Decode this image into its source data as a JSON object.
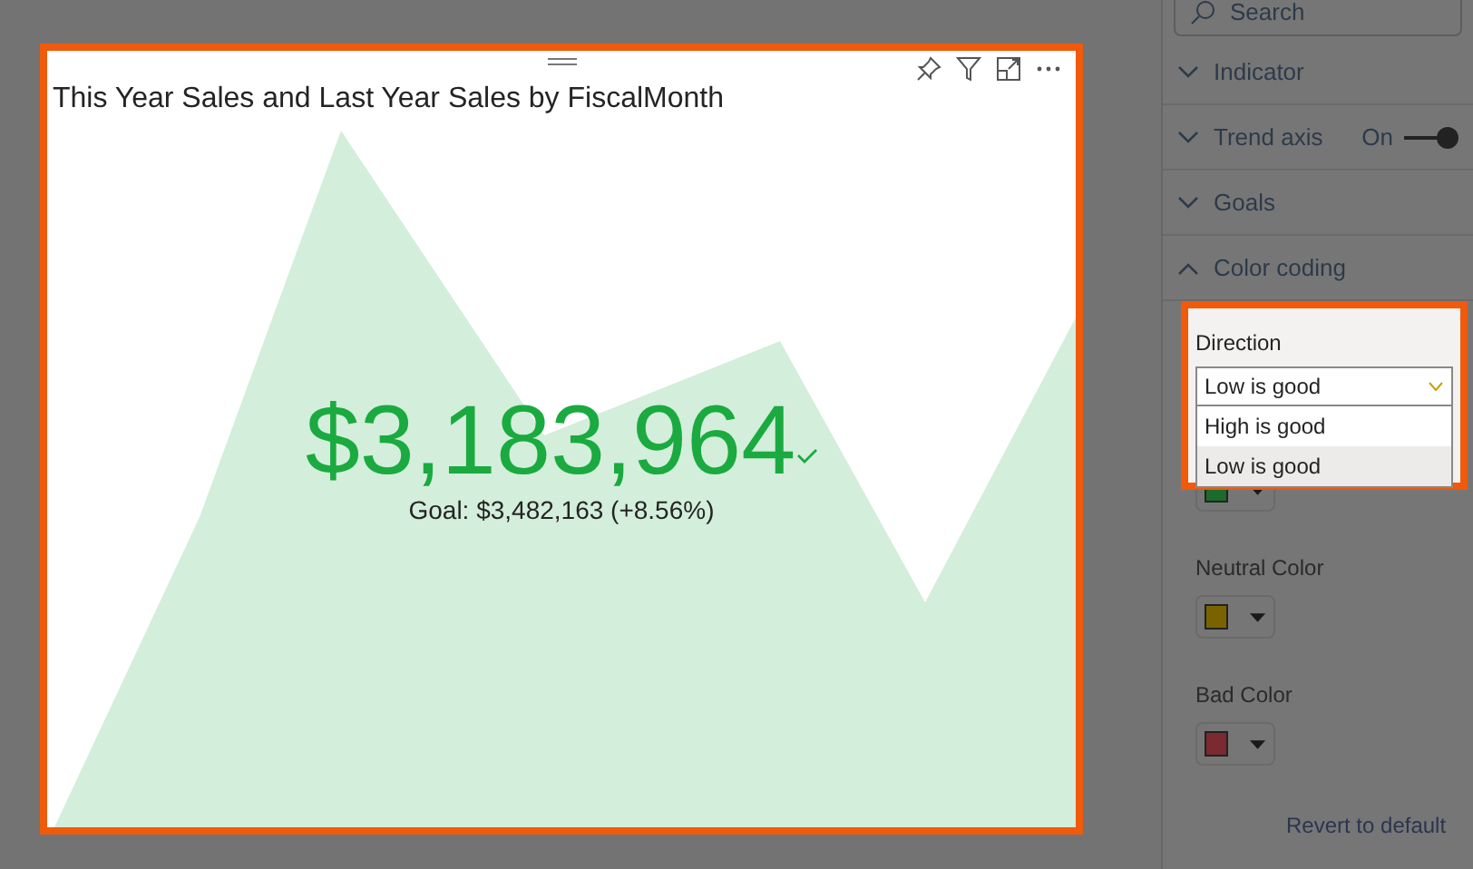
{
  "visual": {
    "title": "This Year Sales and Last Year Sales by FiscalMonth",
    "value": "$3,183,964",
    "goal": "Goal: $3,482,163 (+8.56%)"
  },
  "pane": {
    "search": {
      "placeholder": "Search"
    },
    "sections": [
      {
        "label": "Indicator",
        "expanded": false
      },
      {
        "label": "Trend axis",
        "expanded": false,
        "toggle_label": "On",
        "on": true
      },
      {
        "label": "Goals",
        "expanded": false
      },
      {
        "label": "Color coding",
        "expanded": true
      }
    ],
    "direction": {
      "label": "Direction",
      "value": "Low is good",
      "options": [
        {
          "label": "High is good",
          "selected": false
        },
        {
          "label": "Low is good",
          "selected": true
        }
      ]
    },
    "color_pickers": [
      {
        "color": "#1a6b2c"
      },
      {
        "label": "Neutral Color",
        "color": "#7a6200"
      },
      {
        "label": "Bad Color",
        "color": "#7a2a30"
      }
    ],
    "revert": "Revert to default"
  }
}
